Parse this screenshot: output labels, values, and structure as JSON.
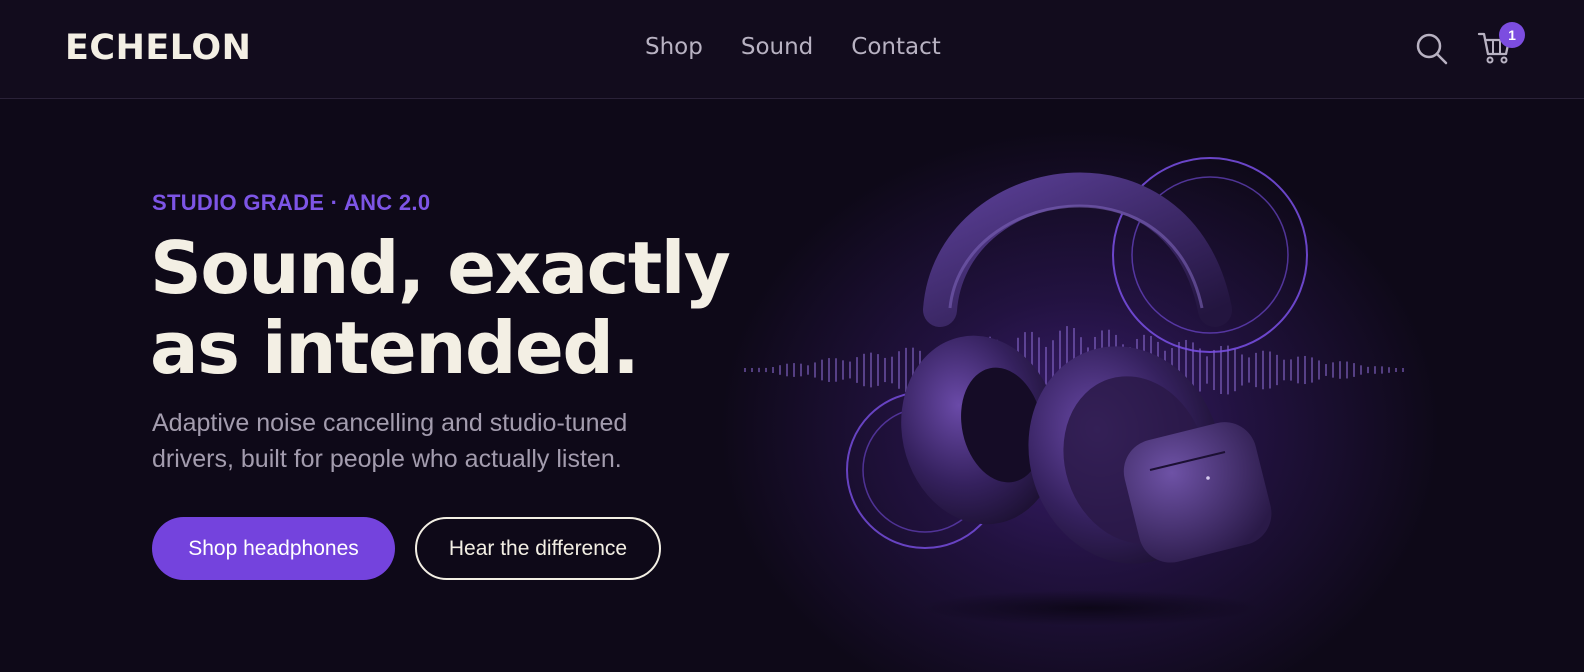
{
  "header": {
    "logo": "ECHELON",
    "nav": [
      {
        "label": "Shop"
      },
      {
        "label": "Sound"
      },
      {
        "label": "Contact"
      }
    ],
    "search_icon": "search-icon",
    "cart_icon": "cart-icon",
    "cart_count": "1"
  },
  "hero": {
    "eyebrow": "STUDIO GRADE · ANC 2.0",
    "headline_line1": "Sound, exactly",
    "headline_line2": "as intended.",
    "subtext_line1": "Adaptive noise cancelling and studio-tuned",
    "subtext_line2": "drivers, built for people who actually listen.",
    "primary_cta": "Shop headphones",
    "secondary_cta": "Hear the difference",
    "image": "headphones-and-earbuds-case"
  },
  "colors": {
    "background": "#0e0918",
    "accent": "#7443dd",
    "eyebrow": "#7d55e6",
    "text": "#f3efe4",
    "muted": "#a39cae"
  }
}
